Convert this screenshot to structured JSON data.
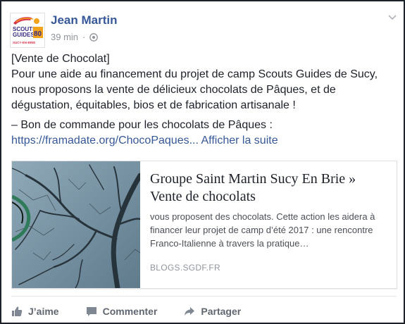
{
  "post": {
    "author": "Jean Martin",
    "time": "39 min",
    "separator": "·",
    "privacy_icon": "globe-icon",
    "options_icon": "chevron-down-icon",
    "logo_lines": [
      "SCOUTS",
      "GUIDES",
      "80",
      "SUCY-EN-BRIE"
    ],
    "body": {
      "line1": "[Vente de Chocolat]",
      "line2": "Pour une aide au financement du projet de camp Scouts Guides de Sucy, nous proposons la vente de délicieux chocolats de Pâques, et de dégustation, équitables, bios et de fabrication artisanale !",
      "line3": "– Bon de commande pour les chocolats de Pâques :",
      "link_url": "https://framadate.org/ChocoPaques...",
      "see_more": "Afficher la suite"
    }
  },
  "card": {
    "title": "Groupe Saint Martin Sucy En Brie » Vente de chocolats",
    "description": "vous proposent des chocolats. Cette action les aidera à financer leur projet de camp d’été 2017 : une rencontre Franco-Italienne à travers la pratique…",
    "source": "BLOGS.SGDF.FR"
  },
  "actions": {
    "like": "J’aime",
    "comment": "Commenter",
    "share": "Partager"
  },
  "colors": {
    "link": "#365899",
    "text": "#1d2129",
    "muted": "#90949c"
  }
}
